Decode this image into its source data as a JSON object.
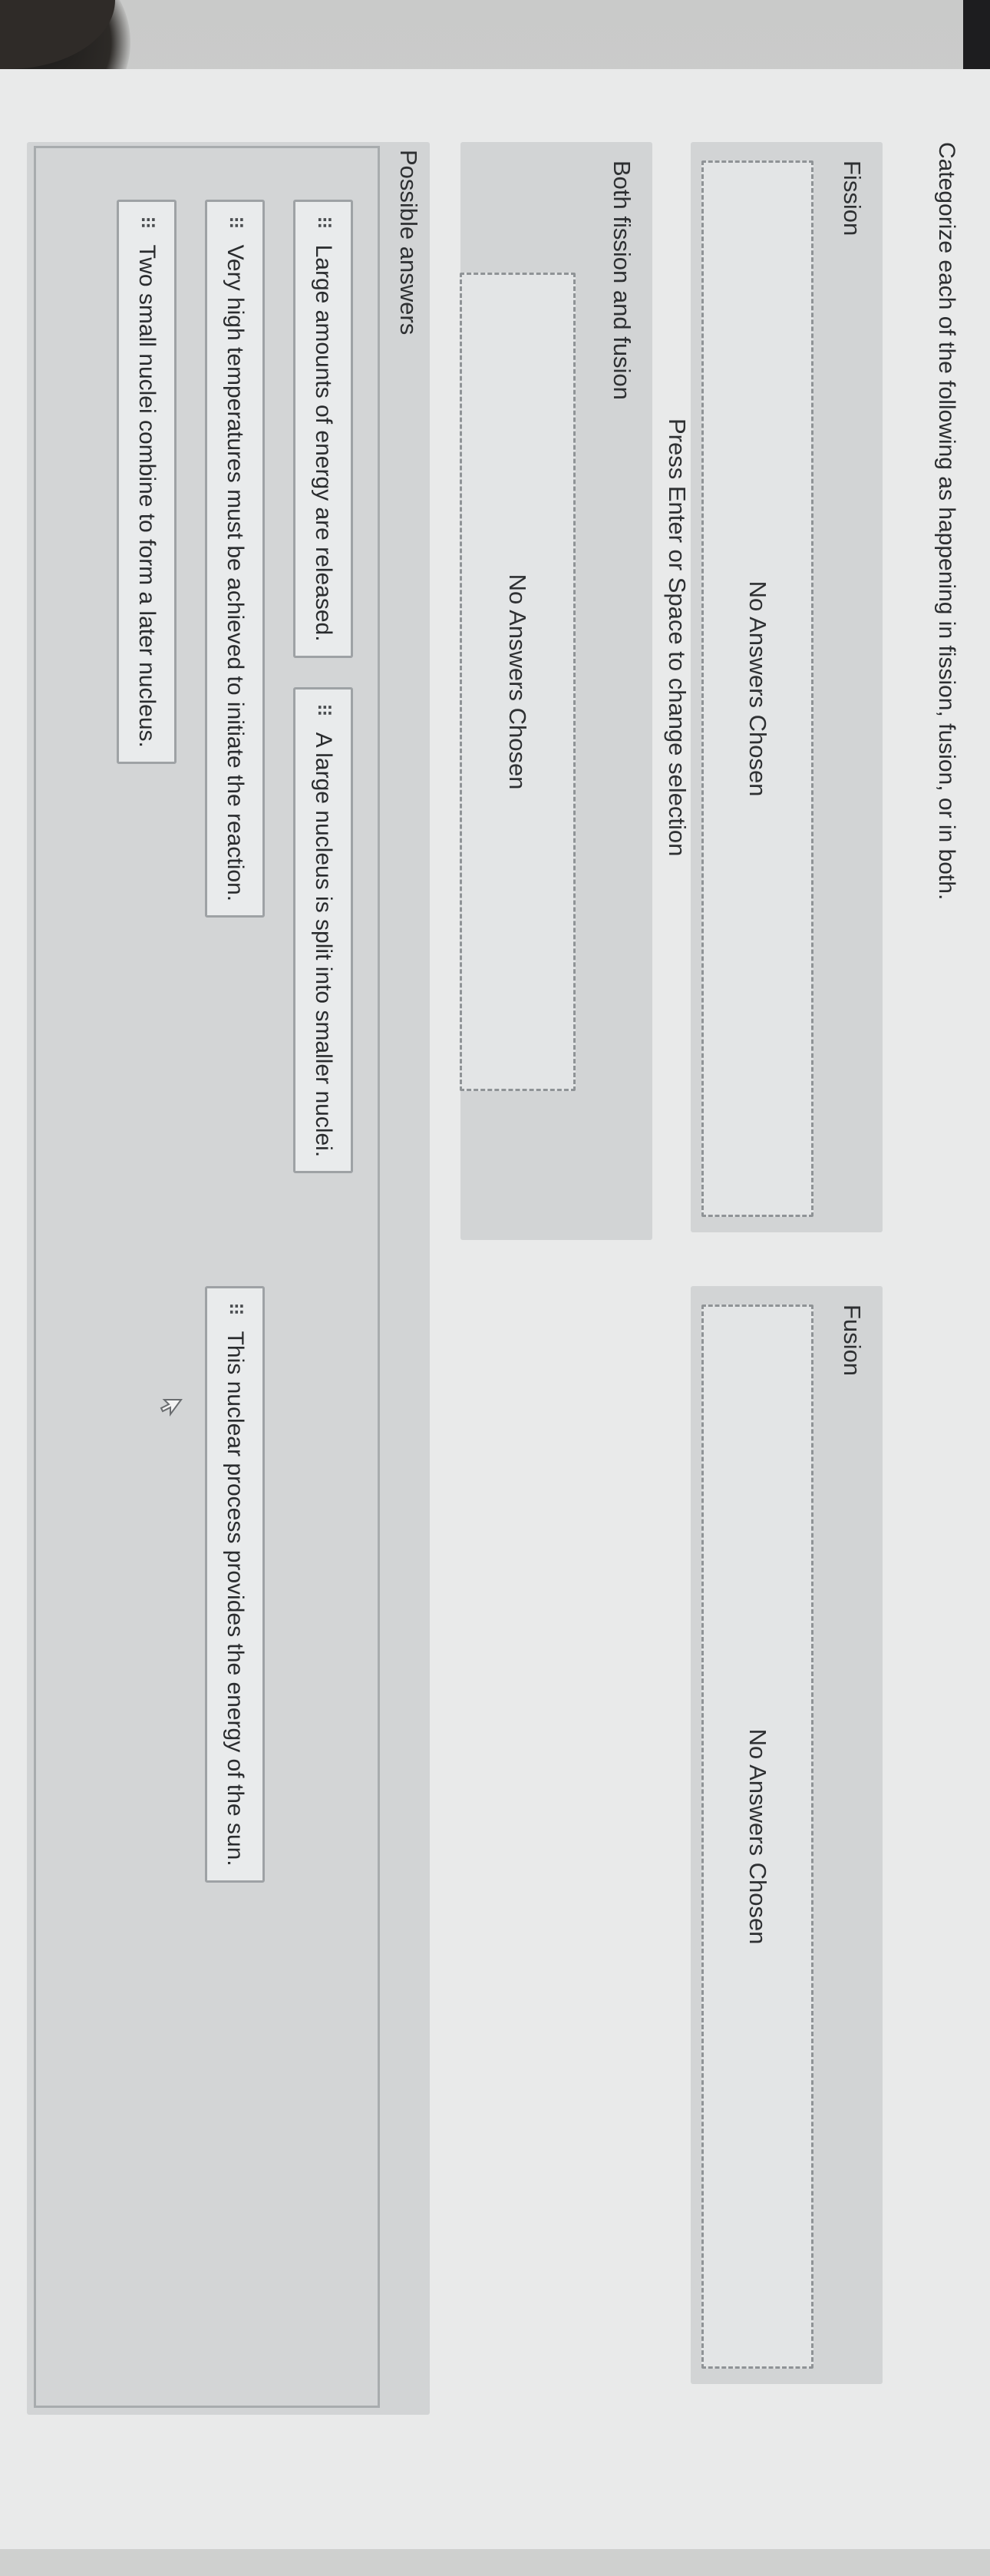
{
  "question": "Categorize each of the following as happening in fission, fusion, or in both.",
  "categories": {
    "fission": {
      "title": "Fission",
      "drop_text": "No Answers Chosen"
    },
    "fusion": {
      "title": "Fusion",
      "drop_text": "No Answers Chosen"
    },
    "both": {
      "title": "Both fission and fusion",
      "drop_text": "No Answers Chosen"
    }
  },
  "hint": "Press Enter or Space to change selection",
  "possible_answers": {
    "title": "Possible answers",
    "grip_glyph": "⠿",
    "items": [
      "Large amounts of energy are released.",
      "A large nucleus is split into smaller nuclei.",
      "Very high temperatures must be achieved to initiate the reaction.",
      "This nuclear process provides the energy of the sun.",
      "Two small nuclei combine to form a later nucleus."
    ]
  },
  "icons": {
    "drag_handle": "drag-handle-icon",
    "cursor": "mouse-pointer-icon"
  }
}
